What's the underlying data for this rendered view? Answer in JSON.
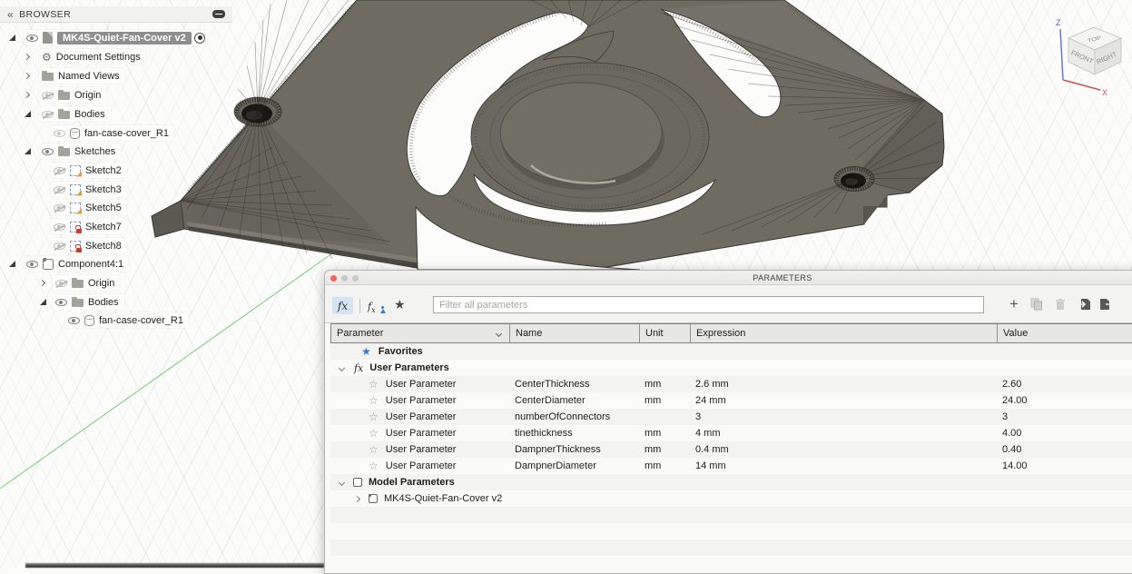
{
  "browser": {
    "title": "BROWSER",
    "tree": [
      {
        "label": "MK4S-Quiet-Fan-Cover v2"
      },
      {
        "label": "Document Settings"
      },
      {
        "label": "Named Views"
      },
      {
        "label": "Origin"
      },
      {
        "label": "Bodies"
      },
      {
        "label": "fan-case-cover_R1"
      },
      {
        "label": "Sketches"
      },
      {
        "label": "Sketch2"
      },
      {
        "label": "Sketch3"
      },
      {
        "label": "Sketch5"
      },
      {
        "label": "Sketch7"
      },
      {
        "label": "Sketch8"
      },
      {
        "label": "Component4:1"
      },
      {
        "label": "Origin"
      },
      {
        "label": "Bodies"
      },
      {
        "label": "fan-case-cover_R1"
      }
    ]
  },
  "viewcube": {
    "z_label": "Z",
    "x_label": "X",
    "top": "TOP",
    "front": "FRONT",
    "right": "RIGHT"
  },
  "parameters": {
    "title": "PARAMETERS",
    "filter_placeholder": "Filter all parameters",
    "columns": {
      "parameter": "Parameter",
      "name": "Name",
      "unit": "Unit",
      "expression": "Expression",
      "value": "Value"
    },
    "favorites_label": "Favorites",
    "user_parameters_label": "User Parameters",
    "model_parameters_label": "Model Parameters",
    "model_component_label": "MK4S-Quiet-Fan-Cover v2",
    "rows": [
      {
        "type": "User Parameter",
        "name": "CenterThickness",
        "unit": "mm",
        "expression": "2.6 mm",
        "value": "2.60"
      },
      {
        "type": "User Parameter",
        "name": "CenterDiameter",
        "unit": "mm",
        "expression": "24 mm",
        "value": "24.00"
      },
      {
        "type": "User Parameter",
        "name": "numberOfConnectors",
        "unit": "",
        "expression": "3",
        "value": "3"
      },
      {
        "type": "User Parameter",
        "name": "tinethickness",
        "unit": "mm",
        "expression": "4 mm",
        "value": "4.00"
      },
      {
        "type": "User Parameter",
        "name": "DampnerThickness",
        "unit": "mm",
        "expression": "0.4 mm",
        "value": "0.40"
      },
      {
        "type": "User Parameter",
        "name": "DampnerDiameter",
        "unit": "mm",
        "expression": "14 mm",
        "value": "14.00"
      }
    ],
    "accent_colors": {
      "favorite_star": "#2e7cd6",
      "selected_fx_bg": "#d6e3f3"
    }
  }
}
